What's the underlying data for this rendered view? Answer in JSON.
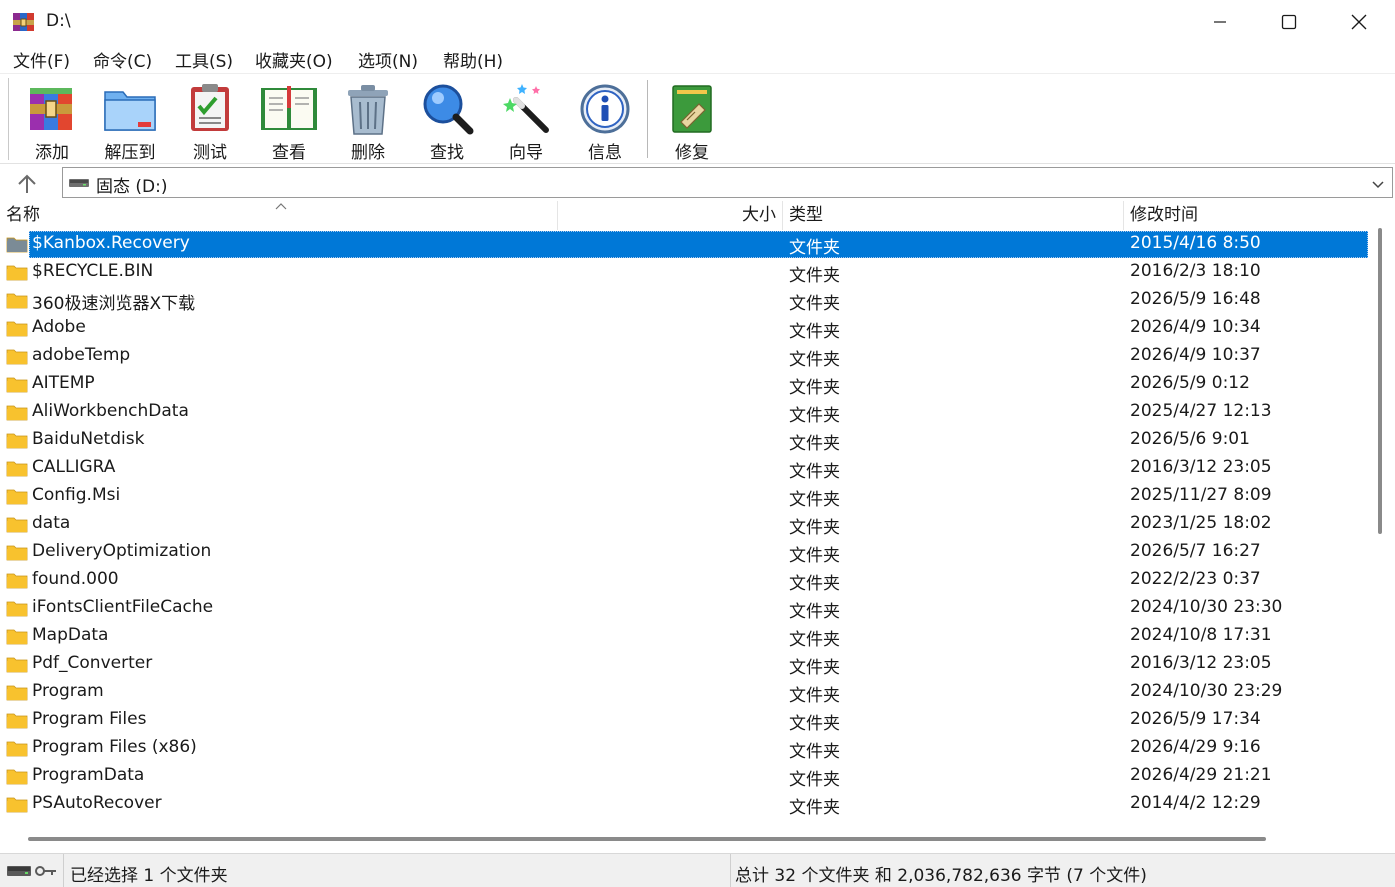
{
  "window": {
    "title": "D:\\"
  },
  "menu": [
    "文件(F)",
    "命令(C)",
    "工具(S)",
    "收藏夹(O)",
    "选项(N)",
    "帮助(H)"
  ],
  "toolbar": {
    "add": "添加",
    "extract": "解压到",
    "test": "测试",
    "view": "查看",
    "delete": "删除",
    "find": "查找",
    "wizard": "向导",
    "info": "信息",
    "repair": "修复"
  },
  "address": {
    "path": "固态 (D:)"
  },
  "columns": {
    "name": "名称",
    "size": "大小",
    "type": "类型",
    "modified": "修改时间"
  },
  "files": [
    {
      "name": "$Kanbox.Recovery",
      "type": "文件夹",
      "modified": "2015/4/16 8:50",
      "selected": true
    },
    {
      "name": "$RECYCLE.BIN",
      "type": "文件夹",
      "modified": "2016/2/3 18:10"
    },
    {
      "name": "360极速浏览器X下载",
      "type": "文件夹",
      "modified": "2026/5/9 16:48"
    },
    {
      "name": "Adobe",
      "type": "文件夹",
      "modified": "2026/4/9 10:34"
    },
    {
      "name": "adobeTemp",
      "type": "文件夹",
      "modified": "2026/4/9 10:37"
    },
    {
      "name": "AITEMP",
      "type": "文件夹",
      "modified": "2026/5/9 0:12"
    },
    {
      "name": "AliWorkbenchData",
      "type": "文件夹",
      "modified": "2025/4/27 12:13"
    },
    {
      "name": "BaiduNetdisk",
      "type": "文件夹",
      "modified": "2026/5/6 9:01"
    },
    {
      "name": "CALLIGRA",
      "type": "文件夹",
      "modified": "2016/3/12 23:05"
    },
    {
      "name": "Config.Msi",
      "type": "文件夹",
      "modified": "2025/11/27 8:09"
    },
    {
      "name": "data",
      "type": "文件夹",
      "modified": "2023/1/25 18:02"
    },
    {
      "name": "DeliveryOptimization",
      "type": "文件夹",
      "modified": "2026/5/7 16:27"
    },
    {
      "name": "found.000",
      "type": "文件夹",
      "modified": "2022/2/23 0:37"
    },
    {
      "name": "iFontsClientFileCache",
      "type": "文件夹",
      "modified": "2024/10/30 23:30"
    },
    {
      "name": "MapData",
      "type": "文件夹",
      "modified": "2024/10/8 17:31"
    },
    {
      "name": "Pdf_Converter",
      "type": "文件夹",
      "modified": "2016/3/12 23:05"
    },
    {
      "name": "Program",
      "type": "文件夹",
      "modified": "2024/10/30 23:29"
    },
    {
      "name": "Program Files",
      "type": "文件夹",
      "modified": "2026/5/9 17:34"
    },
    {
      "name": "Program Files (x86)",
      "type": "文件夹",
      "modified": "2026/4/29 9:16"
    },
    {
      "name": "ProgramData",
      "type": "文件夹",
      "modified": "2026/4/29 21:21"
    },
    {
      "name": "PSAutoRecover",
      "type": "文件夹",
      "modified": "2014/4/2 12:29"
    }
  ],
  "status": {
    "selection": "已经选择 1 个文件夹",
    "total": "总计 32 个文件夹 和 2,036,782,636 字节 (7 个文件)"
  },
  "colors": {
    "selection": "#0078d7",
    "folder": "#f8c22e"
  }
}
